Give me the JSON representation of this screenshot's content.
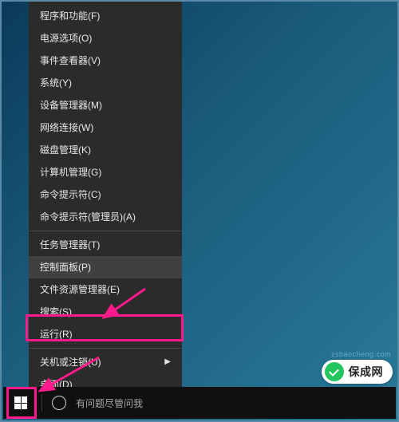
{
  "menu": {
    "items": [
      {
        "label": "程序和功能(F)",
        "hover": false,
        "submenu": false
      },
      {
        "label": "电源选项(O)",
        "hover": false,
        "submenu": false
      },
      {
        "label": "事件查看器(V)",
        "hover": false,
        "submenu": false
      },
      {
        "label": "系统(Y)",
        "hover": false,
        "submenu": false
      },
      {
        "label": "设备管理器(M)",
        "hover": false,
        "submenu": false
      },
      {
        "label": "网络连接(W)",
        "hover": false,
        "submenu": false
      },
      {
        "label": "磁盘管理(K)",
        "hover": false,
        "submenu": false
      },
      {
        "label": "计算机管理(G)",
        "hover": false,
        "submenu": false
      },
      {
        "label": "命令提示符(C)",
        "hover": false,
        "submenu": false
      },
      {
        "label": "命令提示符(管理员)(A)",
        "hover": false,
        "submenu": false
      },
      {
        "sep": true
      },
      {
        "label": "任务管理器(T)",
        "hover": false,
        "submenu": false
      },
      {
        "label": "控制面板(P)",
        "hover": true,
        "submenu": false
      },
      {
        "label": "文件资源管理器(E)",
        "hover": false,
        "submenu": false
      },
      {
        "label": "搜索(S)",
        "hover": false,
        "submenu": false
      },
      {
        "label": "运行(R)",
        "hover": false,
        "submenu": false
      },
      {
        "sep": true
      },
      {
        "label": "关机或注销(U)",
        "hover": false,
        "submenu": true
      },
      {
        "label": "桌面(D)",
        "hover": false,
        "submenu": false
      }
    ]
  },
  "taskbar": {
    "search_placeholder": "有问题尽管问我"
  },
  "watermark": {
    "text": "保成网",
    "url": "zsbaocheng.com"
  },
  "annotations": {
    "arrow_color": "#ff1a8c"
  }
}
